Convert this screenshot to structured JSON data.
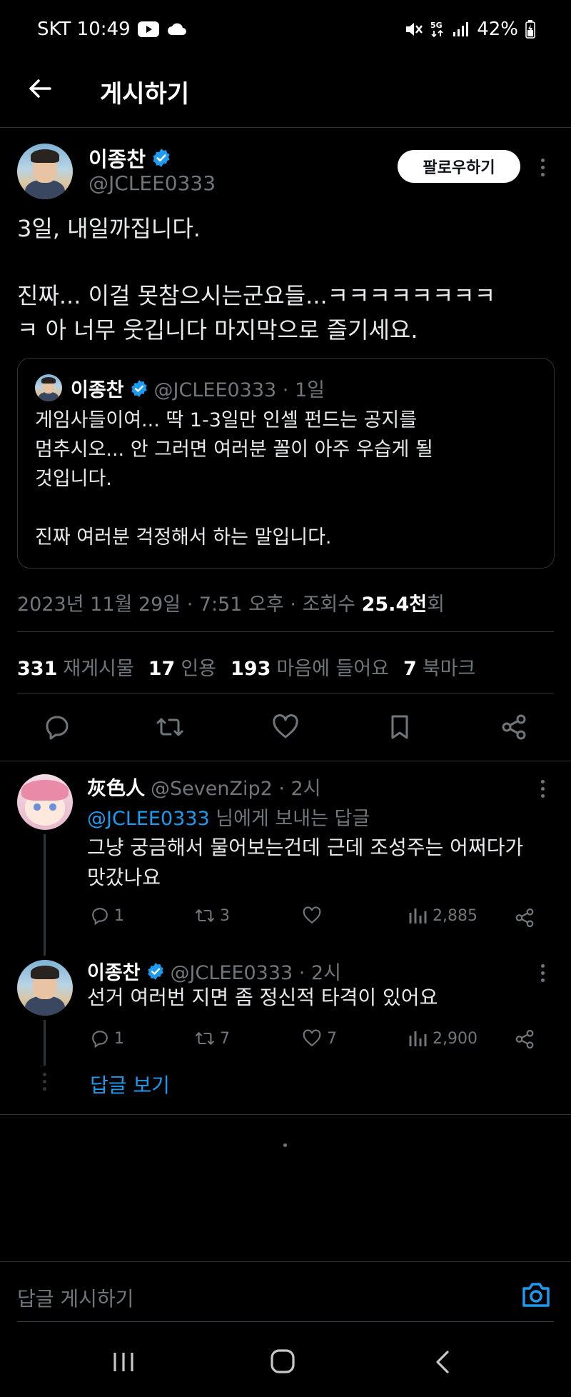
{
  "status_bar": {
    "carrier_time": "SKT 10:49",
    "battery": "42%"
  },
  "header": {
    "title": "게시하기"
  },
  "post": {
    "author_name": "이종찬",
    "author_handle": "@JCLEE0333",
    "follow_label": "팔로우하기",
    "text_line1": "3일, 내일까집니다.",
    "text_line2": "진짜... 이걸 못참으시는군요들...ㅋㅋㅋㅋㅋㅋㅋㅋ",
    "text_line3": "ㅋ 아 너무 웃깁니다 마지막으로 즐기세요.",
    "quote": {
      "author_name": "이종찬",
      "author_handle": "@JCLEE0333 · 1일",
      "text": "게임사들이여... 딱 1-3일만 인셀 펀드는 공지를\n멈추시오... 안 그러면 여러분 꼴이 아주 우습게 될\n것입니다.\n\n진짜 여러분 걱정해서 하는 말입니다."
    },
    "meta_prefix": "2023년 11월 29일 · 7:51 오후 · 조회수 ",
    "views": "25.4천",
    "meta_suffix": "회",
    "stats": [
      {
        "count": "331",
        "label": "재게시물"
      },
      {
        "count": "17",
        "label": "인용"
      },
      {
        "count": "193",
        "label": "마음에 들어요"
      },
      {
        "count": "7",
        "label": "북마크"
      }
    ]
  },
  "replies": [
    {
      "author_name": "灰色人",
      "author_handle": "@SevenZip2 · 2시",
      "reply_to_handle": "@JCLEE0333",
      "reply_to_suffix": " 님에게 보내는 답글",
      "text": "그냥 궁금해서 물어보는건데 근데 조성주는 어쩌다가\n맛갔나요",
      "replies": "1",
      "reposts": "3",
      "likes": "",
      "views": "2,885"
    },
    {
      "author_name": "이종찬",
      "author_handle": "@JCLEE0333 · 2시",
      "text": "선거 여러번 지면 좀 정신적 타격이 있어요",
      "replies": "1",
      "reposts": "7",
      "likes": "7",
      "views": "2,900"
    }
  ],
  "show_replies_label": "답글 보기",
  "compose_placeholder": "답글 게시하기",
  "colors": {
    "background": "#000000",
    "accent": "#1d9bf0",
    "muted": "#71767b",
    "divider": "#2f3336"
  }
}
